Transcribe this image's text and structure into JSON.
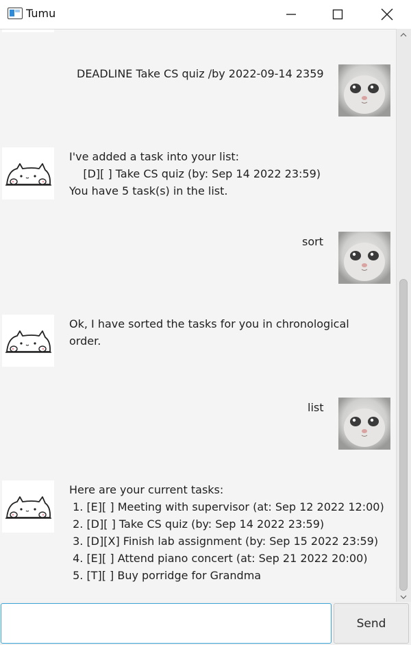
{
  "window": {
    "title": "Tumu",
    "minimize_icon": "minimize-icon",
    "maximize_icon": "maximize-icon",
    "close_icon": "close-icon"
  },
  "chat": {
    "messages": [
      {
        "sender": "user",
        "text": "DEADLINE Take CS quiz /by 2022-09-14 2359"
      },
      {
        "sender": "bot",
        "text": "I've added a task into your list:\n    [D][ ] Take CS quiz (by: Sep 14 2022 23:59)\nYou have 5 task(s) in the list."
      },
      {
        "sender": "user",
        "text": "sort"
      },
      {
        "sender": "bot",
        "text": "Ok, I have sorted the tasks for you in chronological\norder."
      },
      {
        "sender": "user",
        "text": "list"
      },
      {
        "sender": "bot",
        "text": "Here are your current tasks:\n 1. [E][ ] Meeting with supervisor (at: Sep 12 2022 12:00)\n 2. [D][ ] Take CS quiz (by: Sep 14 2022 23:59)\n 3. [D][X] Finish lab assignment (by: Sep 15 2022 23:59)\n 4. [E][ ] Attend piano concert (at: Sep 21 2022 20:00)\n 5. [T][ ] Buy porridge for Grandma"
      }
    ]
  },
  "input": {
    "value": "",
    "placeholder": ""
  },
  "send_button": {
    "label": "Send"
  },
  "colors": {
    "chat_background": "#f4f4f4",
    "input_focus_border": "#3aa3d8"
  }
}
